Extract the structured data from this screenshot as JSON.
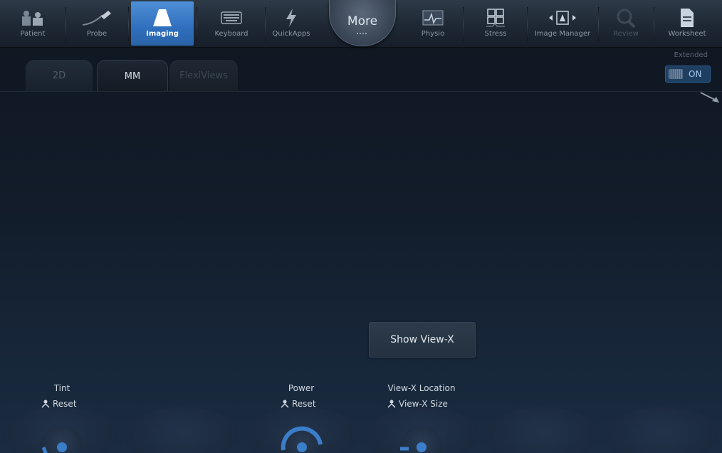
{
  "toolbar": {
    "items": [
      {
        "label": "Patient",
        "icon": "patient-icon"
      },
      {
        "label": "Probe",
        "icon": "probe-icon"
      },
      {
        "label": "Imaging",
        "icon": "imaging-icon",
        "active": true
      },
      {
        "label": "Keyboard",
        "icon": "keyboard-icon"
      },
      {
        "label": "QuickApps",
        "icon": "lightning-icon"
      },
      {
        "label": "Physio",
        "icon": "physio-icon"
      },
      {
        "label": "Stress",
        "icon": "stress-icon"
      },
      {
        "label": "Image Manager",
        "icon": "image-manager-icon"
      },
      {
        "label": "Review",
        "icon": "review-icon",
        "disabled": true
      },
      {
        "label": "Worksheet",
        "icon": "worksheet-icon"
      }
    ],
    "more_label": "More"
  },
  "tabs": [
    {
      "label": "2D",
      "state": "inactive"
    },
    {
      "label": "MM",
      "state": "active"
    },
    {
      "label": "FlexiViews",
      "state": "inactive"
    }
  ],
  "extended": {
    "label": "Extended",
    "toggle_text": "ON"
  },
  "show_view_x": "Show View-X",
  "controls": {
    "tint": {
      "label": "Tint",
      "sub": "Reset"
    },
    "power": {
      "label": "Power",
      "sub": "Reset"
    },
    "view_x_location": {
      "label": "View-X Location",
      "sub": "View-X Size"
    }
  },
  "colors": {
    "accent": "#3a7dc9",
    "active_tab_text": "#d6dde5",
    "background": "#0f1620"
  }
}
